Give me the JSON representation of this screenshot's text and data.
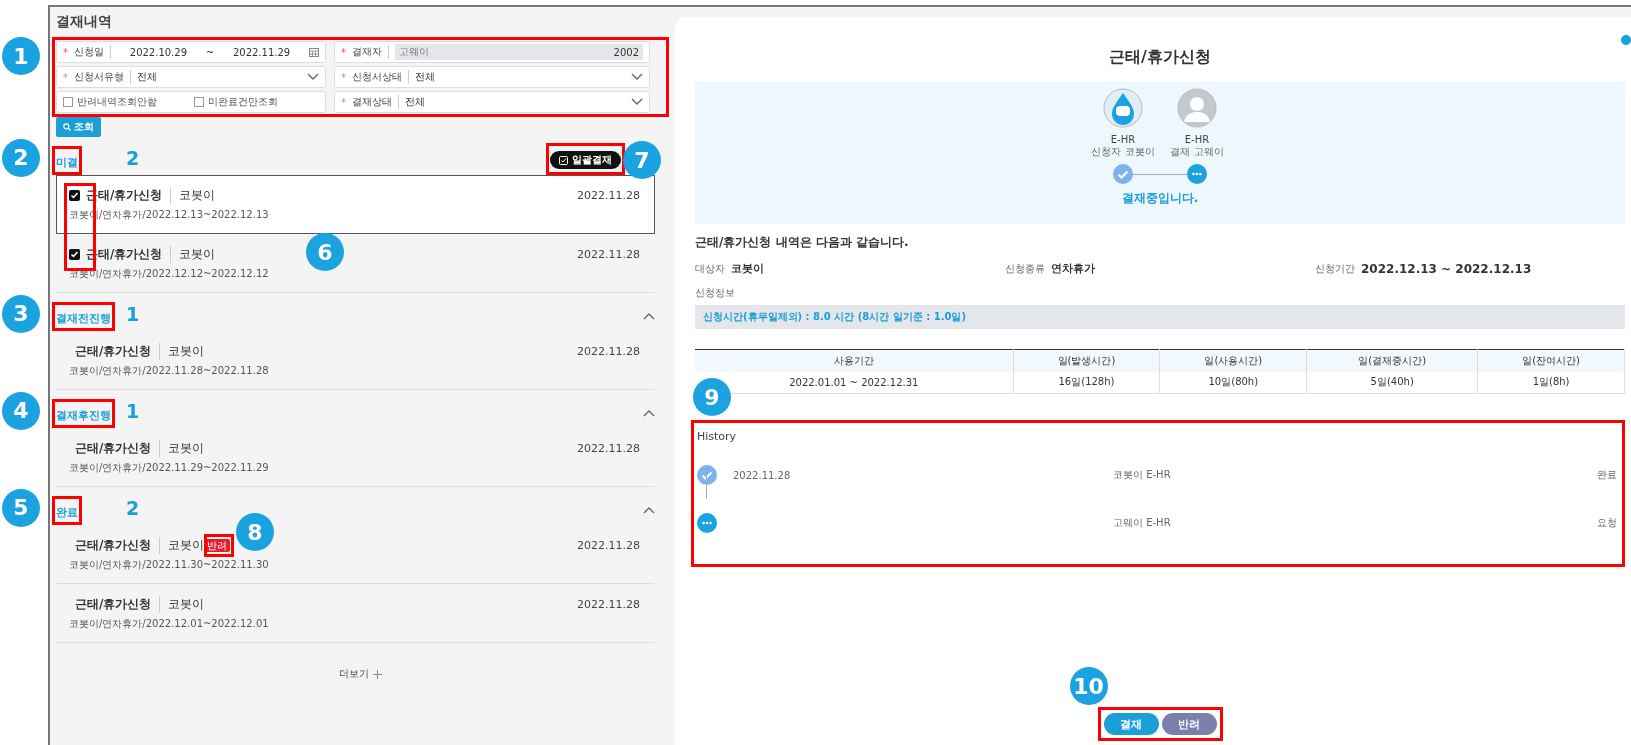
{
  "title": "결재내역",
  "filters": [
    {
      "kind": "daterange",
      "mark": "*",
      "required": true,
      "label": "신청일",
      "from": "2022.10.29",
      "sep": "~",
      "to": "2022.11.29"
    },
    {
      "kind": "readonly",
      "mark": "*",
      "required": true,
      "label": "결재자",
      "value": "고웨이",
      "code": "2002"
    },
    {
      "kind": "select",
      "mark": "*",
      "required": false,
      "label": "신청서유형",
      "value": "전체"
    },
    {
      "kind": "select",
      "mark": "*",
      "required": false,
      "label": "신청서상태",
      "value": "전체"
    },
    {
      "kind": "checks",
      "options": [
        {
          "label": "반려내역조회안함",
          "checked": false
        },
        {
          "label": "미완료건만조회",
          "checked": false
        }
      ]
    },
    {
      "kind": "select",
      "mark": "*",
      "required": false,
      "label": "결재상태",
      "value": "전체"
    }
  ],
  "search_button": "조회",
  "batch_button": "일괄결재",
  "sections": [
    {
      "name": "미결",
      "count": "2",
      "collapsible": false,
      "items": [
        {
          "title": "근태/휴가신청",
          "person": "코봇이",
          "date": "2022.11.28",
          "detail": "코봇이/연차휴가/2022.12.13~2022.12.13",
          "checked": true,
          "selected": true
        },
        {
          "title": "근태/휴가신청",
          "person": "코봇이",
          "date": "2022.11.28",
          "detail": "코봇이/연차휴가/2022.12.12~2022.12.12",
          "checked": true,
          "selected": false
        }
      ]
    },
    {
      "name": "결재전진행",
      "count": "1",
      "collapsible": true,
      "items": [
        {
          "title": "근태/휴가신청",
          "person": "코봇이",
          "date": "2022.11.28",
          "detail": "코봇이/연차휴가/2022.11.28~2022.11.28",
          "selected": false
        }
      ]
    },
    {
      "name": "결재후진행",
      "count": "1",
      "collapsible": true,
      "items": [
        {
          "title": "근태/휴가신청",
          "person": "코봇이",
          "date": "2022.11.28",
          "detail": "코봇이/연차휴가/2022.11.29~2022.11.29",
          "selected": false
        }
      ]
    },
    {
      "name": "완료",
      "count": "2",
      "collapsible": true,
      "items": [
        {
          "title": "근태/휴가신청",
          "person": "코봇이",
          "badge": "반려",
          "date": "2022.11.28",
          "detail": "코봇이/연차휴가/2022.11.30~2022.11.30",
          "selected": false
        },
        {
          "title": "근태/휴가신청",
          "person": "코봇이",
          "date": "2022.11.28",
          "detail": "코봇이/연차휴가/2022.12.01~2022.12.01",
          "selected": false
        }
      ]
    }
  ],
  "more": "더보기",
  "detail": {
    "title": "근태/휴가신청",
    "approvers": [
      {
        "kind": "mascot",
        "system": "E-HR",
        "role": "신청자 코봇이",
        "done": true
      },
      {
        "kind": "person",
        "system": "E-HR",
        "role": "결재 고웨이",
        "done": false
      }
    ],
    "status_text": "결재중입니다.",
    "summary": "근태/휴가신청 내역은 다음과 같습니다.",
    "fields": [
      {
        "label": "대상자",
        "value": "코봇이"
      },
      {
        "label": "신청종류",
        "value": "연차휴가"
      },
      {
        "label": "신청기간",
        "value": "2022.12.13 ~ 2022.12.13"
      }
    ],
    "info_label": "신청정보",
    "info_bar": "신청시간(휴무일제외) : 8.0 시간 (8시간 일기준 : 1.0일)",
    "table": {
      "columns": [
        "사용기간",
        "일(발생시간)",
        "일(사용시간)",
        "일(결재중시간)",
        "일(잔여시간)"
      ],
      "rows": [
        [
          "2022.01.01 ~ 2022.12.31",
          "16일(128h)",
          "10일(80h)",
          "5일(40h)",
          "1일(8h)"
        ]
      ]
    },
    "history": {
      "title": "History",
      "entries": [
        {
          "done": true,
          "date": "2022.11.28",
          "name": "코봇이 E-HR",
          "result": "완료"
        },
        {
          "done": false,
          "name": "고웨이 E-HR",
          "result": "요청"
        }
      ]
    },
    "buttons": [
      {
        "kind": "approve",
        "label": "결재"
      },
      {
        "kind": "reject",
        "label": "반려"
      }
    ]
  },
  "callouts": [
    "1",
    "2",
    "3",
    "4",
    "5",
    "6",
    "7",
    "8",
    "9",
    "10"
  ]
}
